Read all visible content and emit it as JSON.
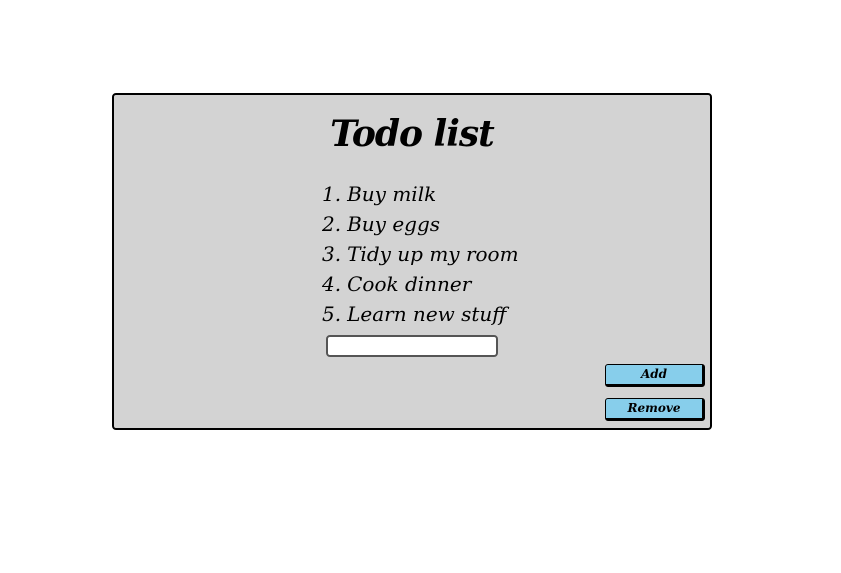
{
  "todo_app": {
    "title": "Todo list",
    "items": [
      {
        "number": "1.",
        "text": "Buy milk"
      },
      {
        "number": "2.",
        "text": "Buy eggs"
      },
      {
        "number": "3.",
        "text": "Tidy up my room"
      },
      {
        "number": "4.",
        "text": "Cook dinner"
      },
      {
        "number": "5.",
        "text": "Learn new stuff"
      }
    ],
    "input": {
      "value": "",
      "placeholder": ""
    },
    "add_label": "Add",
    "remove_label": "Remove"
  },
  "colors": {
    "card_background": "#d3d3d3",
    "button_background": "#87ceeb",
    "border": "#000000"
  }
}
